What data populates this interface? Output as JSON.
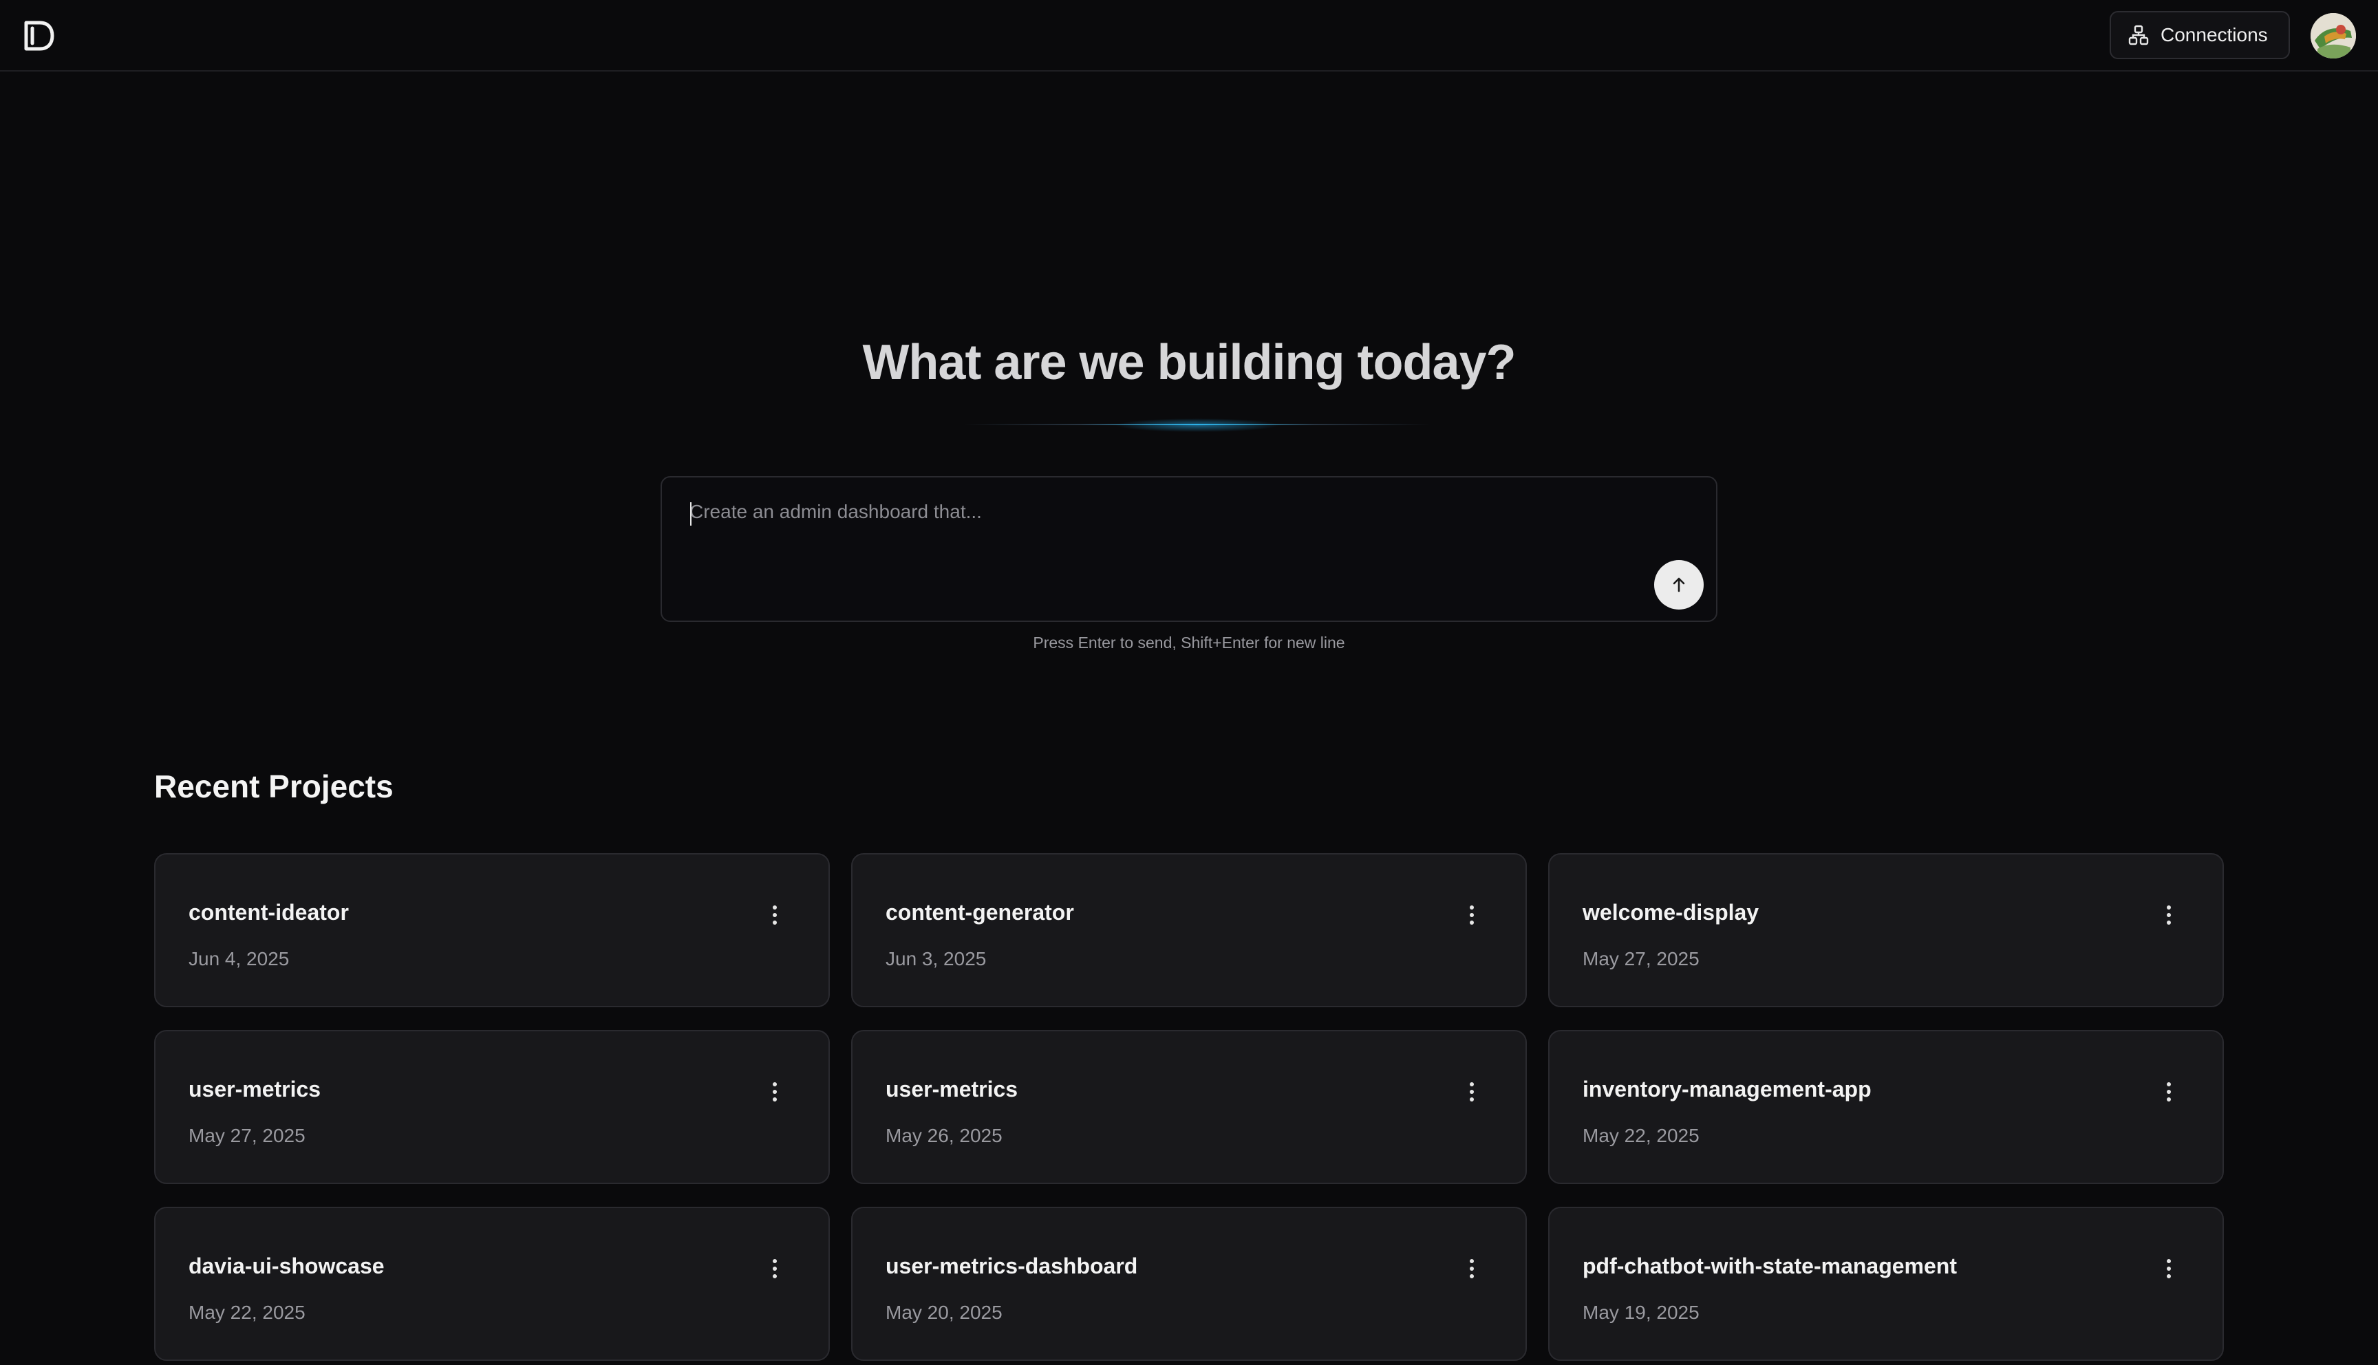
{
  "header": {
    "logo_icon": "davia-logo-icon",
    "connections_label": "Connections",
    "connections_icon": "network-icon",
    "avatar_icon": "user-avatar"
  },
  "hero": {
    "title": "What are we building today?",
    "prompt_placeholder": "Create an admin dashboard that...",
    "prompt_value": "",
    "send_icon": "arrow-up-icon",
    "hint": "Press Enter to send, Shift+Enter for new line",
    "accent_color": "#2fb6e8"
  },
  "recent": {
    "title": "Recent Projects",
    "menu_icon": "more-vertical-icon",
    "projects": [
      {
        "name": "content-ideator",
        "date": "Jun 4, 2025"
      },
      {
        "name": "content-generator",
        "date": "Jun 3, 2025"
      },
      {
        "name": "welcome-display",
        "date": "May 27, 2025"
      },
      {
        "name": "user-metrics",
        "date": "May 27, 2025"
      },
      {
        "name": "user-metrics",
        "date": "May 26, 2025"
      },
      {
        "name": "inventory-management-app",
        "date": "May 22, 2025"
      },
      {
        "name": "davia-ui-showcase",
        "date": "May 22, 2025"
      },
      {
        "name": "user-metrics-dashboard",
        "date": "May 20, 2025"
      },
      {
        "name": "pdf-chatbot-with-state-management",
        "date": "May 19, 2025"
      }
    ]
  }
}
